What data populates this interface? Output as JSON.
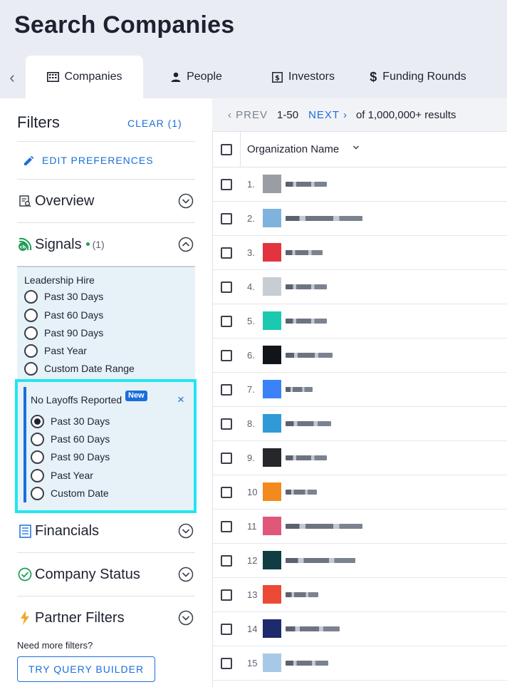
{
  "header": {
    "title": "Search Companies"
  },
  "tabs": [
    {
      "label": "Companies",
      "icon": "building-icon",
      "active": true
    },
    {
      "label": "People",
      "icon": "person-icon",
      "active": false
    },
    {
      "label": "Investors",
      "icon": "dollar-box-icon",
      "active": false
    },
    {
      "label": "Funding Rounds",
      "icon": "dollar-icon",
      "active": false
    }
  ],
  "filters": {
    "title": "Filters",
    "clear_label": "CLEAR (1)",
    "edit_preferences": "EDIT PREFERENCES",
    "sections": {
      "overview": "Overview",
      "signals": "Signals",
      "signals_count": "(1)",
      "financials": "Financials",
      "company_status": "Company Status",
      "partner_filters": "Partner Filters"
    },
    "leadership_hire": {
      "title": "Leadership Hire",
      "options": [
        "Past 30 Days",
        "Past 60 Days",
        "Past 90 Days",
        "Past Year",
        "Custom Date Range"
      ]
    },
    "no_layoffs": {
      "title": "No Layoffs Reported",
      "badge": "New",
      "close": "×",
      "selected": "Past 30 Days",
      "options": [
        "Past 30 Days",
        "Past 60 Days",
        "Past 90 Days",
        "Past Year",
        "Custom Date"
      ]
    },
    "need_more": "Need more filters?",
    "query_builder": "TRY QUERY BUILDER"
  },
  "pagination": {
    "prev": "PREV",
    "range": "1-50",
    "next": "NEXT",
    "results": "of 1,000,000+ results"
  },
  "table": {
    "column_header": "Organization Name",
    "rows": [
      {
        "num": "1.",
        "logo_color": "#9a9da3"
      },
      {
        "num": "2.",
        "logo_color": "#7fb3dd"
      },
      {
        "num": "3.",
        "logo_color": "#e2343f"
      },
      {
        "num": "4.",
        "logo_color": "#c8ccd3"
      },
      {
        "num": "5.",
        "logo_color": "#1bc9b0"
      },
      {
        "num": "6.",
        "logo_color": "#111418"
      },
      {
        "num": "7.",
        "logo_color": "#3b82f6"
      },
      {
        "num": "8.",
        "logo_color": "#2f9ad6"
      },
      {
        "num": "9.",
        "logo_color": "#26272b"
      },
      {
        "num": "10",
        "logo_color": "#f28a1e"
      },
      {
        "num": "11",
        "logo_color": "#e0577a"
      },
      {
        "num": "12",
        "logo_color": "#0f3d44"
      },
      {
        "num": "13",
        "logo_color": "#ec4a35"
      },
      {
        "num": "14",
        "logo_color": "#1d2a6b"
      },
      {
        "num": "15",
        "logo_color": "#a8c8e8"
      }
    ]
  }
}
